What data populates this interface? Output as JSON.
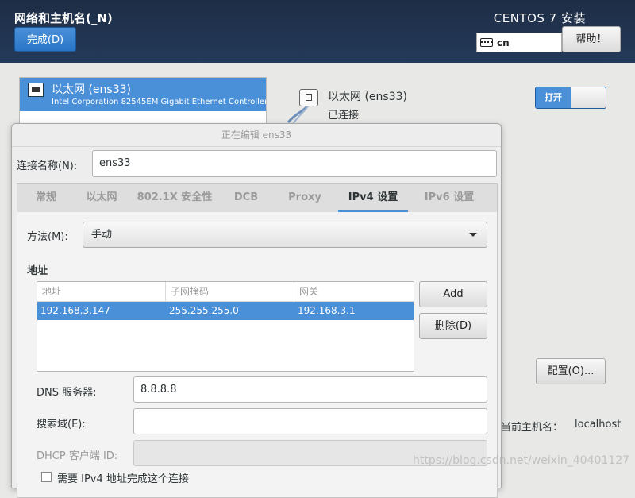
{
  "header": {
    "title": "网络和主机名(_N)",
    "done_label": "完成(D)",
    "product": "CENTOS 7 安装",
    "keyboard_layout": "cn",
    "help_label": "帮助！"
  },
  "device": {
    "name": "以太网 (ens33)",
    "description": "Intel Corporation 82545EM Gigabit Ethernet Controller ("
  },
  "connection": {
    "name": "以太网 (ens33)",
    "status": "已连接",
    "toggle_label": "打开",
    "toggle_state": "on",
    "config_label": "配置(O)..."
  },
  "hostname": {
    "label": "当前主机名：",
    "value": "localhost"
  },
  "dialog": {
    "title": "正在编辑 ens33",
    "conn_name_label": "连接名称(N):",
    "conn_name_value": "ens33",
    "tabs": [
      "常规",
      "以太网",
      "802.1X 安全性",
      "DCB",
      "Proxy",
      "IPv4 设置",
      "IPv6 设置"
    ],
    "active_tab": "IPv4 设置",
    "method_label": "方法(M):",
    "method_value": "手动",
    "address_heading": "地址",
    "address_columns": [
      "地址",
      "子网掩码",
      "网关"
    ],
    "address_rows": [
      [
        "192.168.3.147",
        "255.255.255.0",
        "192.168.3.1"
      ]
    ],
    "add_label": "Add",
    "delete_label": "删除(D)",
    "dns_label": "DNS 服务器:",
    "dns_value": "8.8.8.8",
    "search_label": "搜索域(E):",
    "search_value": "",
    "dhcp_label": "DHCP 客户端 ID:",
    "dhcp_value": "",
    "checkbox_label": "需要 IPv4 地址完成这个连接"
  },
  "watermark": "https://blog.csdn.net/weixin_40401127",
  "colors": {
    "accent": "#4a90d9",
    "header_bg": "#1d2d45"
  }
}
